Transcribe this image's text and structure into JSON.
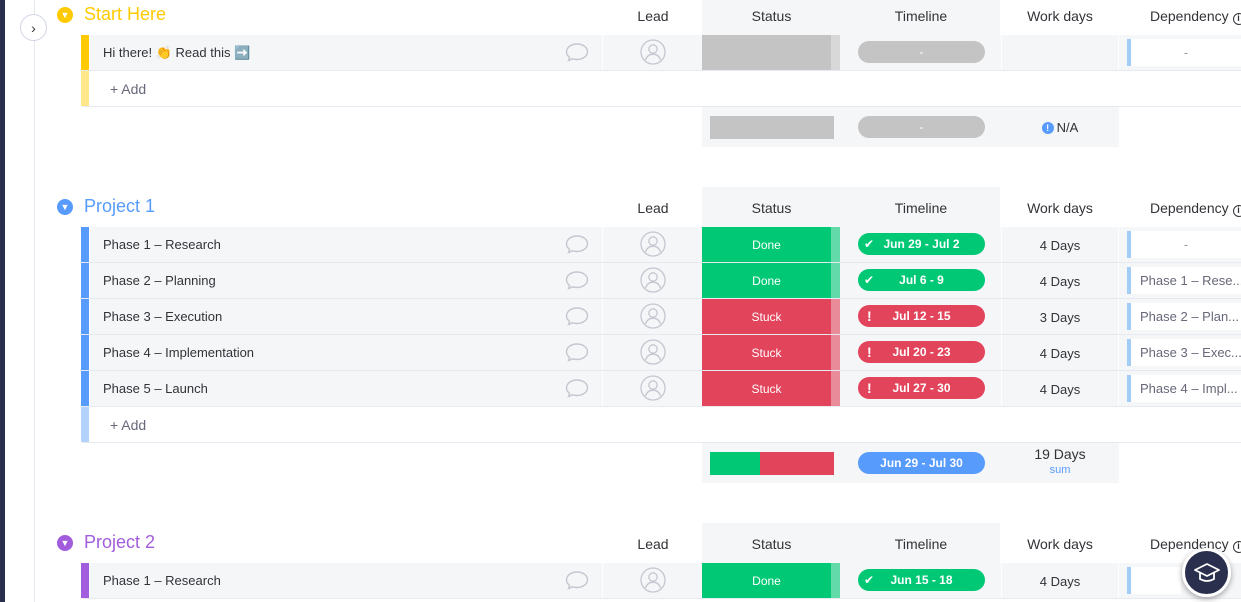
{
  "columns": {
    "lead": "Lead",
    "status": "Status",
    "timeline": "Timeline",
    "work_days": "Work days",
    "dependency": "Dependency"
  },
  "add_label": "+ Add",
  "colors": {
    "done": "#00c875",
    "stuck": "#e2445c",
    "empty": "#c4c4c4",
    "timeline_sum": "#579bfc",
    "group_start": "#ffcb00",
    "group_project1": "#579bfc",
    "group_project2": "#a25ddc"
  },
  "groups": [
    {
      "title": "Start Here",
      "rows": [
        {
          "name": "Hi there! 👏 Read this ➡️",
          "status": "",
          "timeline": "-",
          "work_days": "",
          "dependency": "-"
        }
      ],
      "summary": {
        "timeline": "-",
        "work_days": "N/A",
        "status_done_fraction": 0
      }
    },
    {
      "title": "Project 1",
      "rows": [
        {
          "name": "Phase 1 – Research",
          "status": "Done",
          "timeline": "Jun 29 - Jul 2",
          "work_days": "4 Days",
          "dependency": "-"
        },
        {
          "name": "Phase 2 – Planning",
          "status": "Done",
          "timeline": "Jul 6 - 9",
          "work_days": "4 Days",
          "dependency": "Phase 1 – Rese..."
        },
        {
          "name": "Phase 3 – Execution",
          "status": "Stuck",
          "timeline": "Jul 12 - 15",
          "work_days": "3 Days",
          "dependency": "Phase 2 – Plan..."
        },
        {
          "name": "Phase 4 – Implementation",
          "status": "Stuck",
          "timeline": "Jul 20 - 23",
          "work_days": "4 Days",
          "dependency": "Phase 3 – Exec..."
        },
        {
          "name": "Phase 5 – Launch",
          "status": "Stuck",
          "timeline": "Jul 27 - 30",
          "work_days": "4 Days",
          "dependency": "Phase 4 – Impl..."
        }
      ],
      "summary": {
        "timeline": "Jun 29 - Jul 30",
        "work_days": "19 Days",
        "work_days_sub": "sum",
        "status_done_fraction": 0.4
      }
    },
    {
      "title": "Project 2",
      "rows": [
        {
          "name": "Phase 1 – Research",
          "status": "Done",
          "timeline": "Jun 15 - 18",
          "work_days": "4 Days",
          "dependency": ""
        }
      ]
    }
  ],
  "icons": {
    "collapse": "chevron-right-icon",
    "group_toggle": "chevron-down-icon",
    "updates": "speech-bubble-icon",
    "person": "person-avatar-icon",
    "done_check": "check-icon",
    "stuck_alert": "exclamation-icon",
    "info": "info-icon",
    "help": "graduation-cap-icon"
  }
}
